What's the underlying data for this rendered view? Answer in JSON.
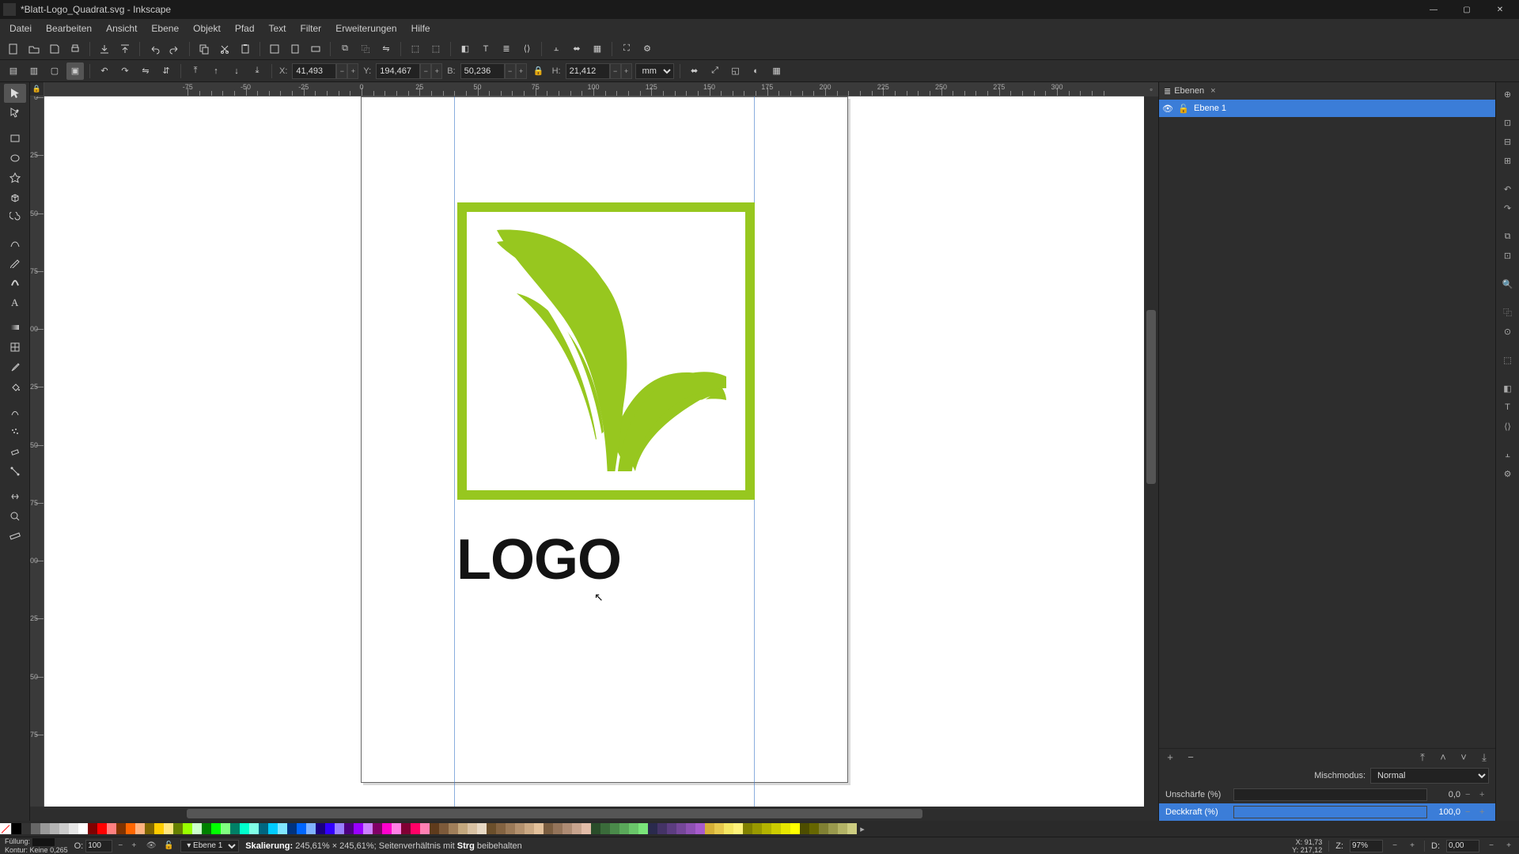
{
  "window": {
    "title": "*Blatt-Logo_Quadrat.svg - Inkscape"
  },
  "menu": [
    "Datei",
    "Bearbeiten",
    "Ansicht",
    "Ebene",
    "Objekt",
    "Pfad",
    "Text",
    "Filter",
    "Erweiterungen",
    "Hilfe"
  ],
  "toolcontrols": {
    "x_label": "X:",
    "x": "41,493",
    "y_label": "Y:",
    "y": "194,467",
    "w_label": "B:",
    "w": "50,236",
    "h_label": "H:",
    "h": "21,412",
    "unit": "mm"
  },
  "layers": {
    "panel_title": "Ebenen",
    "items": [
      {
        "name": "Ebene 1",
        "visible": true,
        "locked": false
      }
    ],
    "blend_label": "Mischmodus:",
    "blend_value": "Normal",
    "blur_label": "Unschärfe (%)",
    "blur_value": "0,0",
    "opacity_label": "Deckkraft (%)",
    "opacity_value": "100,0"
  },
  "canvas": {
    "logo_text": "LOGO"
  },
  "status": {
    "fill_label": "Füllung:",
    "stroke_label": "Kontur:",
    "stroke_value": "Keine",
    "stroke_width": "0,265",
    "opacity_label": "O:",
    "opacity_value": "100",
    "layer": "Ebene 1",
    "message_prefix": "Skalierung:",
    "message_scale": "245,61% × 245,61%;",
    "message_mid": "Seitenverhältnis mit",
    "message_key": "Strg",
    "message_suffix": "beibehalten",
    "cursor_x_label": "X:",
    "cursor_x": "91,73",
    "cursor_y_label": "Y:",
    "cursor_y": "217,12",
    "zoom_label": "Z:",
    "zoom": "97%",
    "rotate_label": "D:",
    "rotate": "0,00"
  },
  "ruler_ticks": [
    -75,
    -50,
    -25,
    0,
    25,
    50,
    75,
    100,
    125,
    150,
    175,
    200,
    225,
    250,
    275,
    300
  ]
}
